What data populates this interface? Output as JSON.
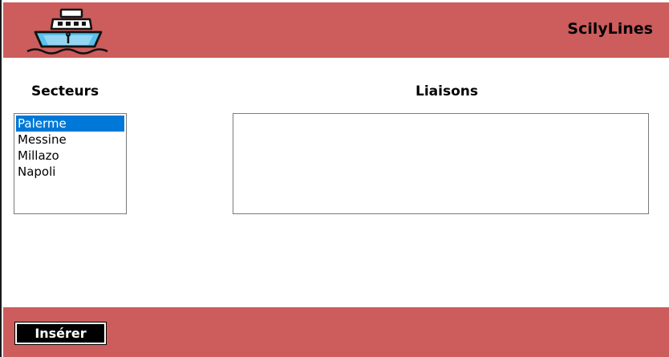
{
  "app": {
    "title": "ScilyLines",
    "logo_icon": "ship-icon"
  },
  "secteurs": {
    "label": "Secteurs",
    "items": [
      "Palerme",
      "Messine",
      "Millazo",
      "Napoli"
    ],
    "selected": "Palerme"
  },
  "liaisons": {
    "label": "Liaisons",
    "items": []
  },
  "footer": {
    "insert_label": "Insérer"
  },
  "colors": {
    "accent": "#cd5c5c",
    "selection": "#0078d7"
  }
}
